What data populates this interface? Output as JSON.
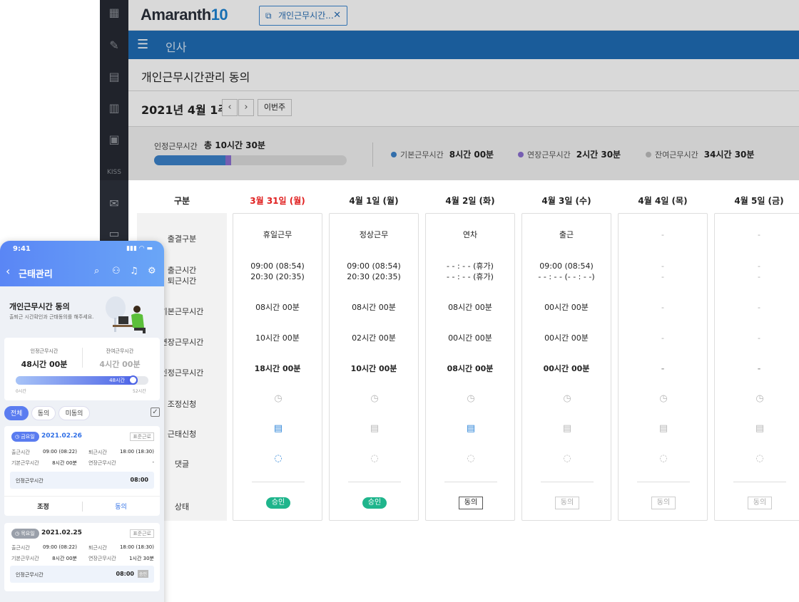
{
  "desktop": {
    "logo": {
      "text": "Amaranth",
      "num": "10"
    },
    "tab": {
      "label": "개인근무시간..."
    },
    "module": "인사",
    "page_title": "개인근무시간관리 동의",
    "week": {
      "label": "2021년 4월 1주",
      "this_week": "이번주"
    },
    "summary": {
      "recognized_label": "인정근무시간",
      "recognized_value": "총 10시간 30분",
      "progress": {
        "basic_fraction": 0.37,
        "overtime_fraction": 0.03
      },
      "legend": [
        {
          "label": "기본근무시간",
          "value": "8시간 00분",
          "color": "#3b82c9"
        },
        {
          "label": "연장근무시간",
          "value": "2시간 30분",
          "color": "#8b6fd1"
        },
        {
          "label": "잔여근무시간",
          "value": "34시간 30분",
          "color": "#bdbdbd"
        }
      ]
    },
    "grid": {
      "corner": "구분",
      "row_labels": [
        "출결구분",
        "출근시간",
        "퇴근시간",
        "기본근무시간",
        "연장근무시간",
        "인정근무시간",
        "조정신청",
        "근태신청",
        "댓글",
        "상태"
      ],
      "days": [
        {
          "header": "3월 31일 (월)",
          "type": "휴일근무",
          "in": "09:00 (08:54)",
          "out": "20:30 (20:35)",
          "basic": "08시간 00분",
          "over": "10시간 00분",
          "total": "18시간 00분",
          "status": "승인"
        },
        {
          "header": "4월 1일 (월)",
          "type": "정상근무",
          "in": "09:00 (08:54)",
          "out": "20:30 (20:35)",
          "basic": "08시간 00분",
          "over": "02시간 00분",
          "total": "10시간 00분",
          "status": "승인"
        },
        {
          "header": "4월 2일 (화)",
          "type": "연차",
          "in": "- - : - - (휴가)",
          "out": "- - : - - (휴가)",
          "basic": "08시간 00분",
          "over": "00시간 00분",
          "total": "08시간 00분",
          "status": "동의"
        },
        {
          "header": "4월 3일 (수)",
          "type": "출근",
          "in": "09:00 (08:54)",
          "out": "- - : - - (- - : - -)",
          "basic": "00시간 00분",
          "over": "00시간 00분",
          "total": "00시간 00분",
          "status": "동의"
        },
        {
          "header": "4월 4일 (목)",
          "type": "-",
          "in": "-",
          "out": "-",
          "basic": "-",
          "over": "-",
          "total": "-",
          "status": "동의"
        },
        {
          "header": "4월 5일 (금)",
          "type": "-",
          "in": "-",
          "out": "-",
          "basic": "-",
          "over": "-",
          "total": "-",
          "status": "동의"
        }
      ]
    }
  },
  "mobile": {
    "time": "9:41",
    "title": "근태관리",
    "hero_title": "개인근무시간 동의",
    "hero_sub": "출퇴근 시간확인과 근태동의를 해주세요.",
    "summary": {
      "rec_label": "인정근무시간",
      "rec_value": "48시간 00분",
      "rem_label": "잔여근무시간",
      "rem_value": "4시간 00분",
      "bar_label": "48시간",
      "bar_fraction": 0.92,
      "min": "0시간",
      "max": "52시간"
    },
    "filters": [
      "전체",
      "동의",
      "미동의"
    ],
    "cards": [
      {
        "badge": "금요일",
        "date": "2021.02.26",
        "tag": "표준근로",
        "in_label": "출근시간",
        "in_value": "09:00 (08:22)",
        "out_label": "퇴근시간",
        "out_value": "18:00 (18:30)",
        "basic_label": "기본근무시간",
        "basic_value": "8시간 00분",
        "over_label": "연장근무시간",
        "over_value": "-",
        "rec_label": "인정근무시간",
        "rec_value": "08:00",
        "btn_adjust": "조정",
        "btn_agree": "동의"
      },
      {
        "badge": "목요일",
        "date": "2021.02.25",
        "tag": "표준근로",
        "in_label": "출근시간",
        "in_value": "09:00 (08:22)",
        "out_label": "퇴근시간",
        "out_value": "18:00 (18:30)",
        "basic_label": "기본근무시간",
        "basic_value": "8시간 00분",
        "over_label": "연장근무시간",
        "over_value": "1시간 30분",
        "rec_label": "인정근무시간",
        "rec_value": "08:00",
        "status": "승인"
      }
    ]
  }
}
